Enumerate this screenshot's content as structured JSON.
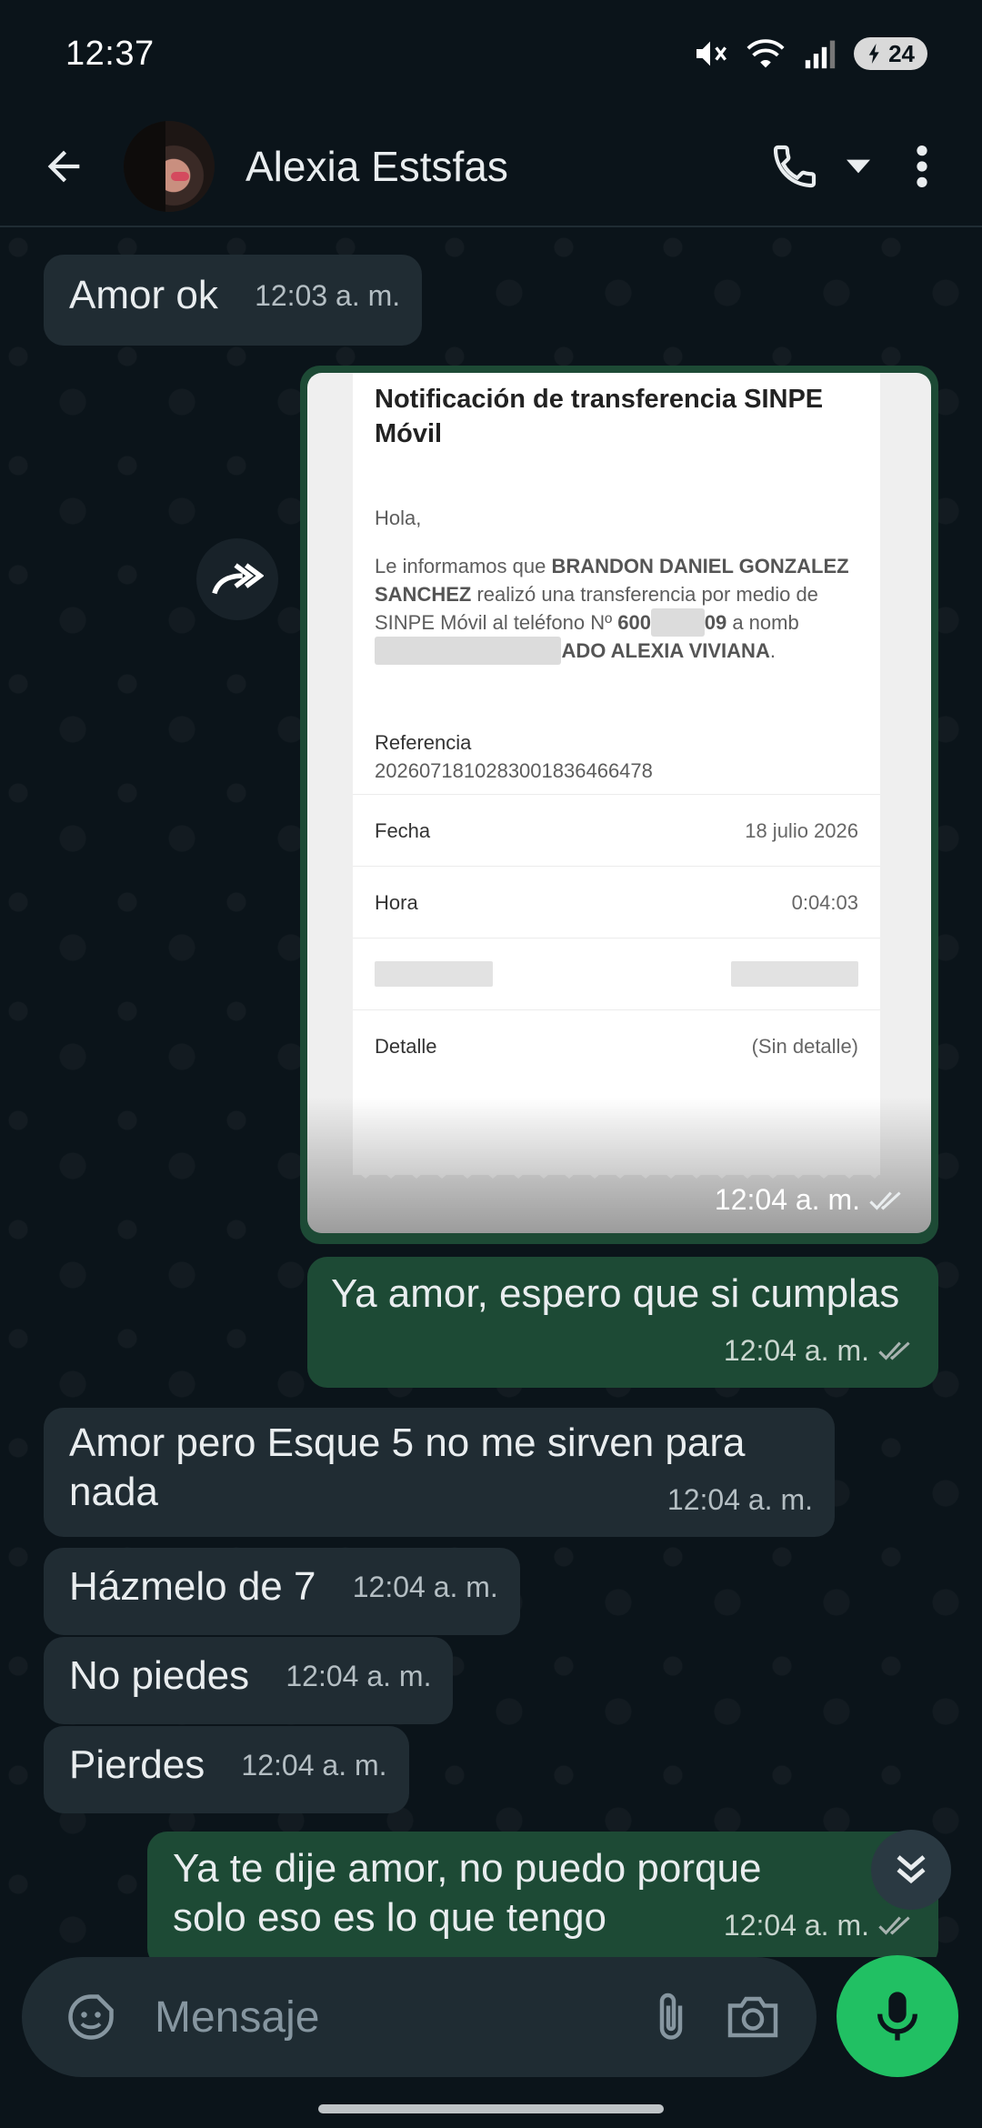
{
  "status_bar": {
    "time": "12:37",
    "battery": "24"
  },
  "header": {
    "contact_name": "Alexia Estsfas"
  },
  "messages": [
    {
      "direction": "in",
      "text": "Amor ok",
      "time": "12:03 a. m."
    },
    {
      "direction": "out",
      "type": "image",
      "time": "12:04 a. m."
    },
    {
      "direction": "out",
      "text": "Ya amor, espero que si cumplas",
      "time": "12:04 a. m."
    },
    {
      "direction": "in",
      "text": "Amor pero Esque 5 no me sirven para nada",
      "time": "12:04 a. m."
    },
    {
      "direction": "in",
      "text": "Házmelo de 7",
      "time": "12:04 a. m."
    },
    {
      "direction": "in",
      "text": "No piedes",
      "time": "12:04 a. m."
    },
    {
      "direction": "in",
      "text": "Pierdes",
      "time": "12:04 a. m."
    },
    {
      "direction": "out",
      "text": "Ya te dije amor, no puedo porque solo eso es lo que tengo",
      "time": "12:04 a. m."
    }
  ],
  "receipt": {
    "title": "Notificación de transferencia SINPE Móvil",
    "greeting": "Hola,",
    "body_pre": "Le informamos que",
    "sender": "BRANDON DANIEL GONZALEZ SANCHEZ",
    "body_mid": "realizó una transferencia por medio de SINPE Móvil al teléfono Nº",
    "phone_start": "600",
    "phone_end": "09",
    "body_to": "a nomb",
    "recipient_end": "ADO ALEXIA VIVIANA",
    "reference_label": "Referencia",
    "reference_value": "2026071810283001836466478",
    "rows": [
      {
        "label": "Fecha",
        "value": "18 julio 2026"
      },
      {
        "label": "Hora",
        "value": "0:04:03"
      },
      {
        "label": "Detalle",
        "value": "(Sin detalle)"
      }
    ]
  },
  "input": {
    "placeholder": "Mensaje"
  },
  "colors": {
    "incoming_bubble": "#202c33",
    "outgoing_bubble": "#1d4a35",
    "mic_button": "#21c063",
    "read_ticks": "#a8b3b0"
  },
  "icons": [
    "back-arrow-icon",
    "phone-icon",
    "chevron-down-icon",
    "more-vert-icon",
    "forward-icon",
    "double-chevron-down-icon",
    "sticker-icon",
    "attach-icon",
    "camera-icon",
    "mic-icon",
    "double-check-icon"
  ]
}
